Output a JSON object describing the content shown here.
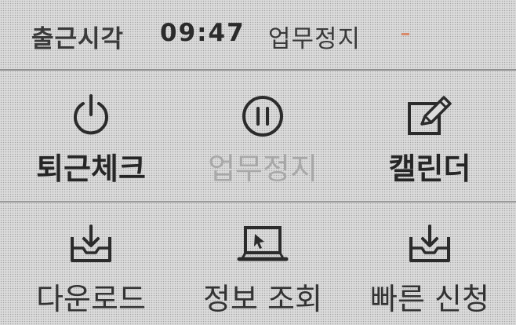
{
  "status": {
    "start_label": "출근시각",
    "start_time": "09:47",
    "state": "업무정지"
  },
  "menu": {
    "row1": [
      {
        "label": "퇴근체크",
        "icon": "power-icon",
        "enabled": true
      },
      {
        "label": "업무정지",
        "icon": "pause-icon",
        "enabled": false
      },
      {
        "label": "캘린더",
        "icon": "edit-note-icon",
        "enabled": true
      }
    ],
    "row2": [
      {
        "label": "다운로드",
        "icon": "download-tray-icon",
        "enabled": true
      },
      {
        "label": "정보 조회",
        "icon": "laptop-cursor-icon",
        "enabled": true
      },
      {
        "label": "빠른 신청",
        "icon": "inbox-download-icon",
        "enabled": true
      }
    ]
  },
  "colors": {
    "background": "#dcdcdc",
    "text": "#262626",
    "disabled_text": "#a8a8a8",
    "accent_dot": "#d98a6a"
  }
}
